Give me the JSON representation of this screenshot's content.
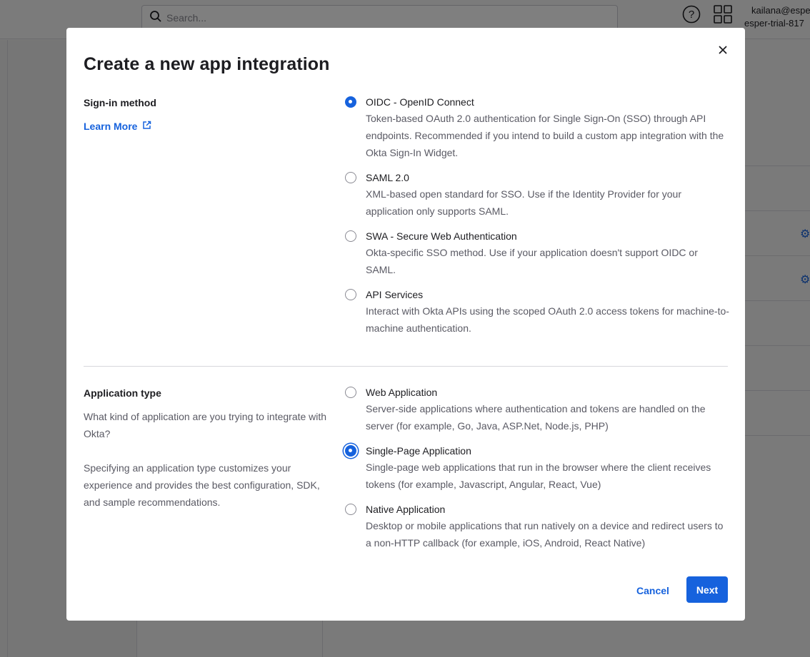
{
  "background": {
    "search_placeholder": "Search...",
    "user_email": "kailana@espe",
    "user_org": "esper-trial-817"
  },
  "modal": {
    "title": "Create a new app integration",
    "sign_in": {
      "label": "Sign-in method",
      "learn_more": "Learn More",
      "options": [
        {
          "label": "OIDC - OpenID Connect",
          "desc": "Token-based OAuth 2.0 authentication for Single Sign-On (SSO) through API endpoints. Recommended if you intend to build a custom app integration with the Okta Sign-In Widget.",
          "checked": true
        },
        {
          "label": "SAML 2.0",
          "desc": "XML-based open standard for SSO. Use if the Identity Provider for your application only supports SAML.",
          "checked": false
        },
        {
          "label": "SWA - Secure Web Authentication",
          "desc": "Okta-specific SSO method. Use if your application doesn't support OIDC or SAML.",
          "checked": false
        },
        {
          "label": "API Services",
          "desc": "Interact with Okta APIs using the scoped OAuth 2.0 access tokens for machine-to-machine authentication.",
          "checked": false
        }
      ]
    },
    "app_type": {
      "label": "Application type",
      "desc1": "What kind of application are you trying to integrate with Okta?",
      "desc2": "Specifying an application type customizes your experience and provides the best configuration, SDK, and sample recommendations.",
      "options": [
        {
          "label": "Web Application",
          "desc": "Server-side applications where authentication and tokens are handled on the server (for example, Go, Java, ASP.Net, Node.js, PHP)",
          "checked": false
        },
        {
          "label": "Single-Page Application",
          "desc": "Single-page web applications that run in the browser where the client receives tokens (for example, Javascript, Angular, React, Vue)",
          "checked": true
        },
        {
          "label": "Native Application",
          "desc": "Desktop or mobile applications that run natively on a device and redirect users to a non-HTTP callback (for example, iOS, Android, React Native)",
          "checked": false
        }
      ]
    },
    "cancel_label": "Cancel",
    "next_label": "Next"
  }
}
